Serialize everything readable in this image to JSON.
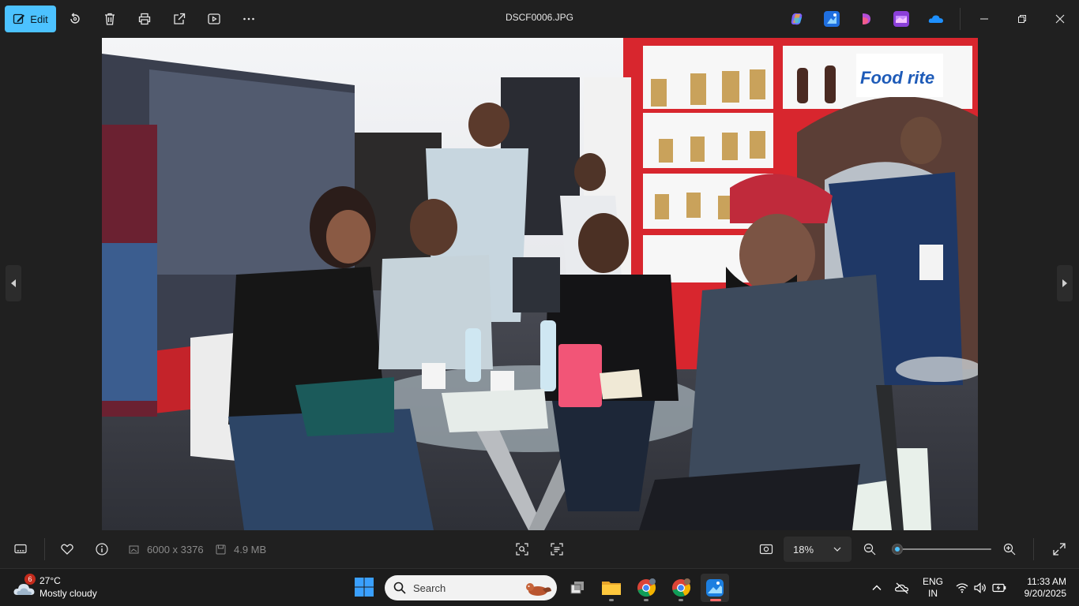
{
  "toolbar": {
    "edit_label": "Edit",
    "file_name": "DSCF0006.JPG",
    "icons": [
      "rotate-icon",
      "delete-icon",
      "print-icon",
      "share-icon",
      "slideshow-icon",
      "more-icon"
    ]
  },
  "info_bar": {
    "dimensions": "6000 x 3376",
    "file_size": "4.9 MB",
    "zoom_value": "18%",
    "zoom_level": 0.05
  },
  "taskbar": {
    "weather_temp": "27°C",
    "weather_desc": "Mostly cloudy",
    "weather_badge": "6",
    "search_placeholder": "Search",
    "lang_line1": "ENG",
    "lang_line2": "IN",
    "time": "11:33 AM",
    "date": "9/20/2025"
  },
  "colors": {
    "accent": "#4cc2ff",
    "background": "#202020",
    "taskbar": "#1c1c1c"
  }
}
